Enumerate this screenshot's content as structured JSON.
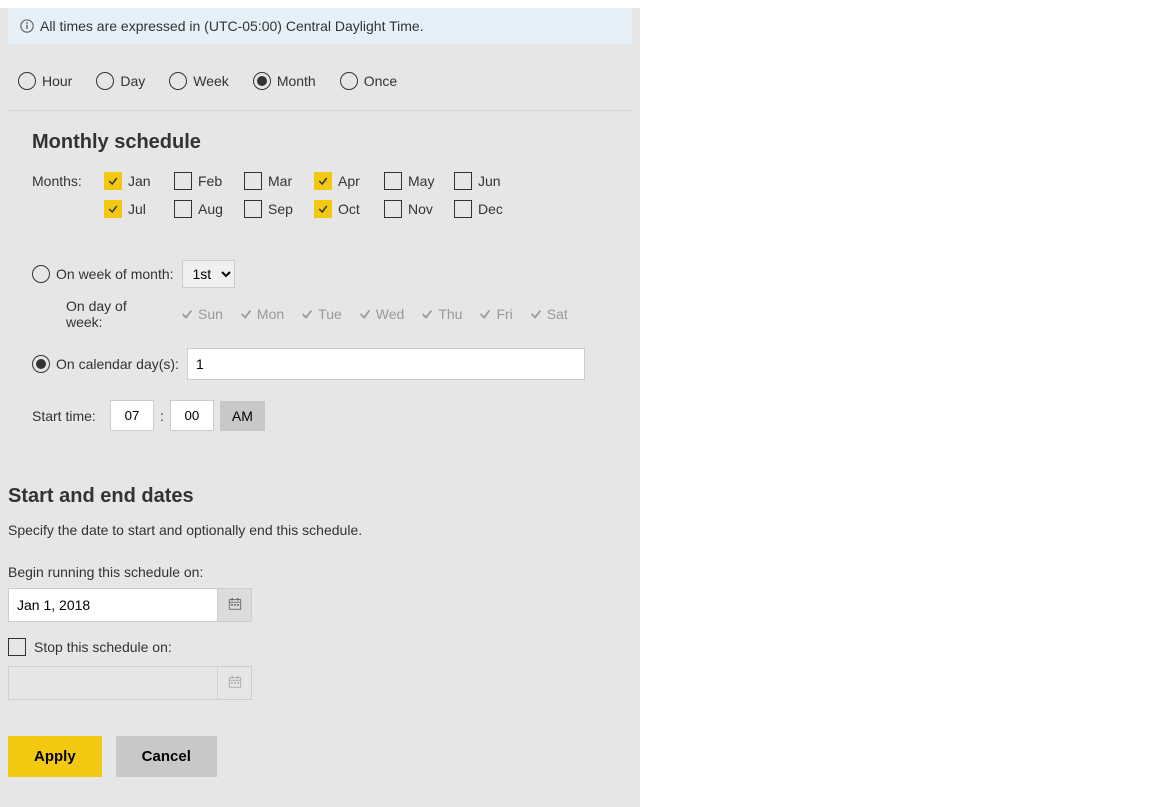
{
  "info_banner": "All times are expressed in (UTC-05:00) Central Daylight Time.",
  "frequency": {
    "options": [
      "Hour",
      "Day",
      "Week",
      "Month",
      "Once"
    ],
    "selected": "Month"
  },
  "monthly": {
    "title": "Monthly schedule",
    "months_label": "Months:",
    "months": [
      {
        "label": "Jan",
        "checked": true
      },
      {
        "label": "Feb",
        "checked": false
      },
      {
        "label": "Mar",
        "checked": false
      },
      {
        "label": "Apr",
        "checked": true
      },
      {
        "label": "May",
        "checked": false
      },
      {
        "label": "Jun",
        "checked": false
      },
      {
        "label": "Jul",
        "checked": true
      },
      {
        "label": "Aug",
        "checked": false
      },
      {
        "label": "Sep",
        "checked": false
      },
      {
        "label": "Oct",
        "checked": true
      },
      {
        "label": "Nov",
        "checked": false
      },
      {
        "label": "Dec",
        "checked": false
      }
    ],
    "week_of_month": {
      "label": "On week of month:",
      "value": "1st",
      "selected": false
    },
    "day_of_week": {
      "label": "On day of week:",
      "days": [
        "Sun",
        "Mon",
        "Tue",
        "Wed",
        "Thu",
        "Fri",
        "Sat"
      ]
    },
    "calendar_days": {
      "label": "On calendar day(s):",
      "value": "1",
      "selected": true
    },
    "start_time": {
      "label": "Start time:",
      "hour": "07",
      "minute": "00",
      "ampm": "AM"
    }
  },
  "dates": {
    "title": "Start and end dates",
    "description": "Specify the date to start and optionally end this schedule.",
    "begin_label": "Begin running this schedule on:",
    "begin_value": "Jan 1, 2018",
    "stop_label": "Stop this schedule on:",
    "stop_checked": false,
    "stop_value": ""
  },
  "buttons": {
    "apply": "Apply",
    "cancel": "Cancel"
  }
}
